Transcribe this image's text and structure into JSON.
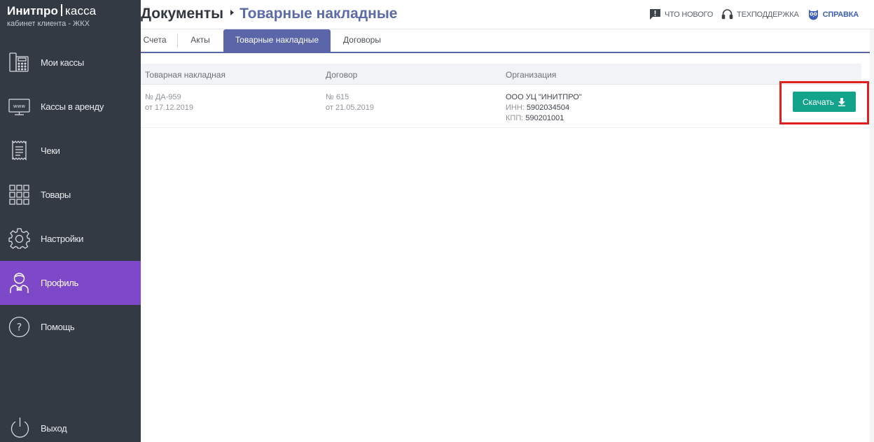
{
  "brand": {
    "name": "Инитпро",
    "product": "касса",
    "subtitle": "кабинет клиента - ЖКХ"
  },
  "sidebar": {
    "items": [
      {
        "label": "Мои кассы",
        "icon": "cash-register-icon"
      },
      {
        "label": "Кассы в аренду",
        "icon": "monitor-www-icon"
      },
      {
        "label": "Чеки",
        "icon": "receipt-icon"
      },
      {
        "label": "Товары",
        "icon": "grid-icon"
      },
      {
        "label": "Настройки",
        "icon": "gear-icon"
      },
      {
        "label": "Профиль",
        "icon": "user-icon",
        "active": true
      },
      {
        "label": "Помощь",
        "icon": "question-icon"
      }
    ],
    "logout": {
      "label": "Выход",
      "icon": "power-icon"
    }
  },
  "header": {
    "breadcrumb": {
      "root": "Документы",
      "current": "Товарные накладные"
    },
    "links": [
      {
        "label": "Что нового",
        "icon": "chat-alert-icon"
      },
      {
        "label": "Техподдержка",
        "icon": "headset-icon"
      },
      {
        "label": "Справка",
        "icon": "owl-icon"
      }
    ]
  },
  "tabs": [
    {
      "label": "Счета"
    },
    {
      "label": "Акты"
    },
    {
      "label": "Товарные накладные",
      "active": true
    },
    {
      "label": "Договоры"
    }
  ],
  "table": {
    "columns": [
      "Товарная накладная",
      "Договор",
      "Организация"
    ],
    "rows": [
      {
        "invoice_number": "№ ДА-959",
        "invoice_date": "от 17.12.2019",
        "contract_number": "№ 615",
        "contract_date": "от 21.05.2019",
        "org_name": "ООО УЦ \"ИНИТПРО\"",
        "inn_label": "ИНН:",
        "inn_value": "5902034504",
        "kpp_label": "КПП:",
        "kpp_value": "590201001",
        "download_label": "Скачать"
      }
    ]
  },
  "colors": {
    "sidebar": "#333a44",
    "active": "#7d49c8",
    "accent": "#5a66a8",
    "button": "#13a28a",
    "highlight": "#e01f1f"
  }
}
